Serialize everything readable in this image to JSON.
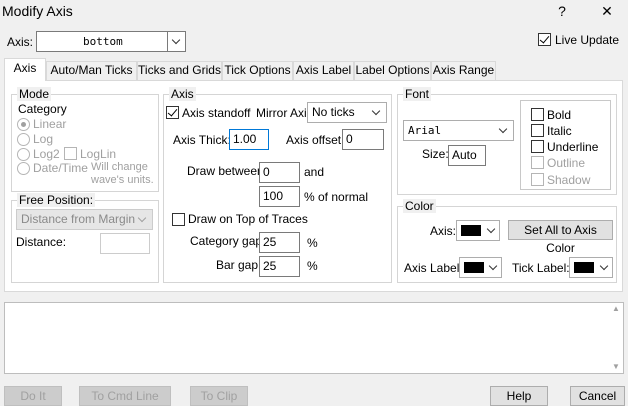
{
  "window": {
    "title": "Modify Axis",
    "help_glyph": "?",
    "close_glyph": "✕"
  },
  "axis_selector": {
    "label": "Axis:",
    "value": "bottom"
  },
  "live_update": {
    "label": "Live Update",
    "checked": true
  },
  "tabs": [
    {
      "label": "Axis",
      "active": true
    },
    {
      "label": "Auto/Man Ticks"
    },
    {
      "label": "Ticks and Grids"
    },
    {
      "label": "Tick Options"
    },
    {
      "label": "Axis Label"
    },
    {
      "label": "Label Options"
    },
    {
      "label": "Axis Range"
    }
  ],
  "mode": {
    "title": "Mode",
    "category_label": "Category",
    "options": {
      "linear": "Linear",
      "log": "Log",
      "log2": "Log2",
      "loglin": "LogLin",
      "datetime": "Date/Time"
    },
    "selected": "Linear",
    "note_line1": "Will change",
    "note_line2": "wave's units."
  },
  "free_position": {
    "title": "Free Position:",
    "combo_value": "Distance from Margin",
    "distance_label": "Distance:",
    "distance_value": ""
  },
  "axis_group": {
    "title": "Axis",
    "standoff_label": "Axis standoff",
    "standoff_checked": true,
    "mirror_label": "Mirror Axis:",
    "mirror_value": "No ticks",
    "thick_label": "Axis Thick:",
    "thick_value": "1.00",
    "offset_label": "Axis offset:",
    "offset_value": "0",
    "draw_between_label": "Draw between",
    "draw_between_from": "0",
    "and_label": "and",
    "draw_between_to": "100",
    "percent_label": "% of normal",
    "draw_on_top_label": "Draw on Top of Traces",
    "draw_on_top_checked": false,
    "category_gap_label": "Category gap:",
    "category_gap_value": "25",
    "bar_gap_label": "Bar gap:",
    "bar_gap_value": "25",
    "pct_symbol": "%"
  },
  "font_group": {
    "title": "Font",
    "font_value": "Arial",
    "size_label": "Size:",
    "size_value": "Auto",
    "styles": {
      "bold": "Bold",
      "italic": "Italic",
      "underline": "Underline",
      "outline": "Outline",
      "shadow": "Shadow"
    }
  },
  "color_group": {
    "title": "Color",
    "axis_label": "Axis:",
    "set_all_button": "Set All to Axis Color",
    "axis_label_label": "Axis Label:",
    "tick_label_label": "Tick Label:",
    "swatch_color": "#000000"
  },
  "buttons": {
    "do_it": "Do It",
    "to_cmd_line": "To Cmd Line",
    "to_clip": "To Clip",
    "help": "Help",
    "cancel": "Cancel"
  },
  "scroll": {
    "up": "▲",
    "down": "▼"
  }
}
